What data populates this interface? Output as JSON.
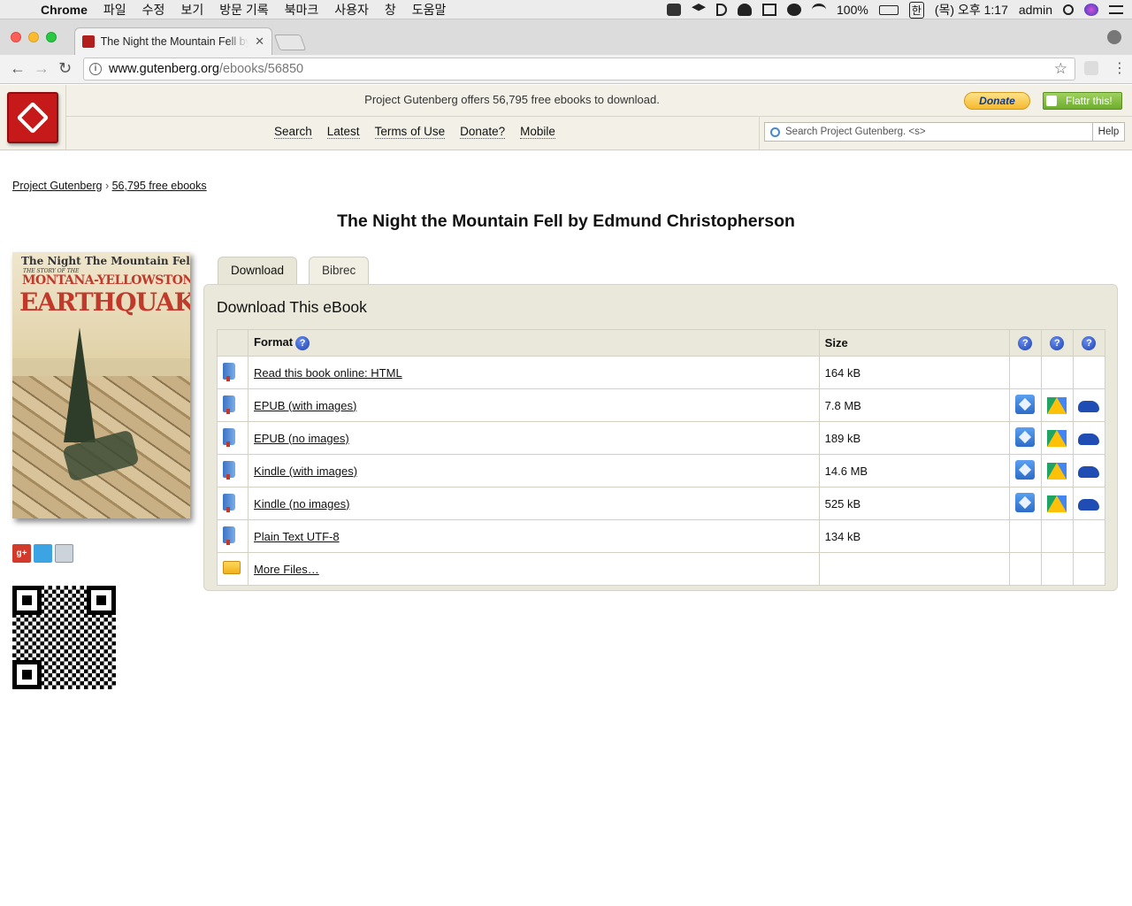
{
  "menubar": {
    "app": "Chrome",
    "items": [
      "파일",
      "수정",
      "보기",
      "방문 기록",
      "북마크",
      "사용자",
      "창",
      "도움말"
    ],
    "battery": "100%",
    "ime": "한",
    "clock": "(목) 오후 1:17",
    "user": "admin"
  },
  "browser": {
    "tab_title": "The Night the Mountain Fell by Edmund Christopherson",
    "url_host": "www.gutenberg.org",
    "url_path": "/ebooks/56850"
  },
  "pg_header": {
    "offer": "Project Gutenberg offers 56,795 free ebooks to download.",
    "donate_label": "Donate",
    "flattr_label": "Flattr this!",
    "nav": [
      "Search",
      "Latest",
      "Terms of Use",
      "Donate?",
      "Mobile"
    ],
    "search_placeholder": "Search Project Gutenberg. <s>",
    "help_label": "Help"
  },
  "breadcrumb": {
    "home": "Project Gutenberg",
    "separator": "›",
    "ebooks": "56,795 free ebooks"
  },
  "book": {
    "title": "The Night the Mountain Fell by Edmund Christopherson",
    "cover_text": {
      "line1": "The Night The Mountain Fell",
      "line2": "THE STORY OF THE",
      "line3": "MONTANA-YELLOWSTONE",
      "line4": "EARTHQUAKE"
    }
  },
  "tabs": [
    "Download",
    "Bibrec"
  ],
  "download": {
    "heading": "Download This eBook",
    "headers": {
      "format": "Format",
      "size": "Size"
    },
    "rows": [
      {
        "format": "Read this book online: HTML",
        "size": "164 kB",
        "icon": "book-icon",
        "cloud": false
      },
      {
        "format": "EPUB (with images)",
        "size": "7.8 MB",
        "icon": "book-icon",
        "cloud": true
      },
      {
        "format": "EPUB (no images)",
        "size": "189 kB",
        "icon": "book-icon",
        "cloud": true
      },
      {
        "format": "Kindle (with images)",
        "size": "14.6 MB",
        "icon": "book-icon",
        "cloud": true
      },
      {
        "format": "Kindle (no images)",
        "size": "525 kB",
        "icon": "book-icon",
        "cloud": true
      },
      {
        "format": "Plain Text UTF-8",
        "size": "134 kB",
        "icon": "book-icon",
        "cloud": false
      },
      {
        "format": "More Files…",
        "size": "",
        "icon": "folder-icon",
        "cloud": false
      }
    ]
  },
  "share_icons": [
    "google-plus-icon",
    "twitter-icon",
    "print-icon"
  ],
  "colors": {
    "pg_red": "#c61a1a",
    "header_bg": "#f3f1e7",
    "panel_bg": "#eae8da"
  }
}
